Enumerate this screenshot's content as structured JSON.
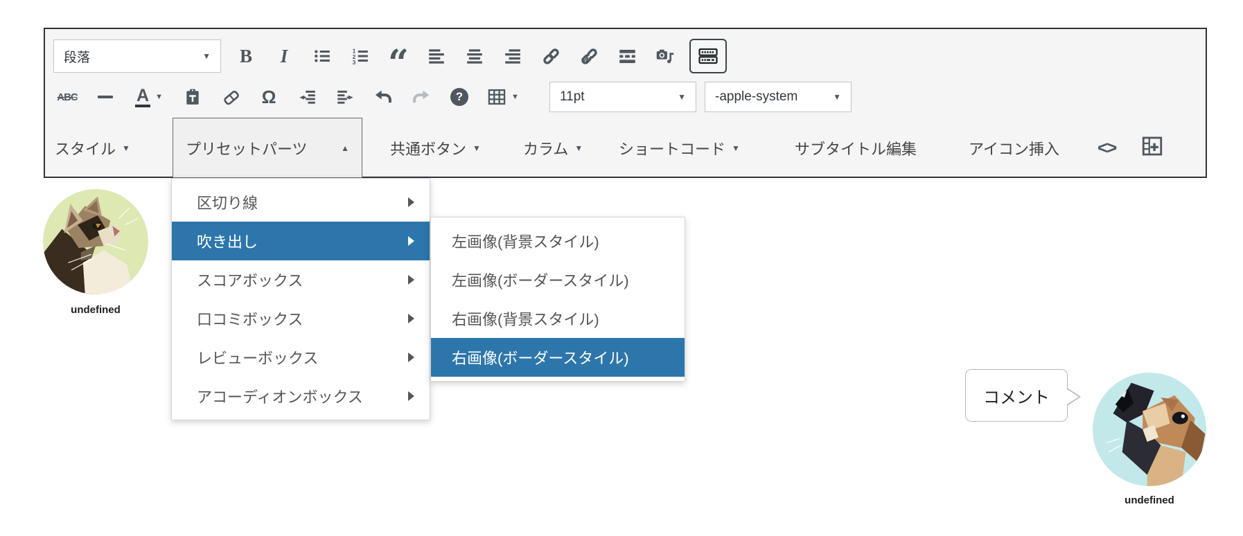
{
  "toolbar": {
    "block_format_value": "段落",
    "font_size_value": "11pt",
    "font_family_value": "-apple-system",
    "bold_glyph": "B",
    "italic_glyph": "I",
    "quote_glyph": "“",
    "strikethrough_glyph": "ABC",
    "special_char_glyph": "Ω",
    "help_glyph": "?",
    "code_glyph": "<>",
    "text_color_glyph": "A",
    "arrow_down": "▼",
    "arrow_up": "▲",
    "ol_digits": [
      "1",
      "2",
      "3"
    ],
    "row3": {
      "style_label": "スタイル",
      "preset_parts_label": "プリセットパーツ",
      "common_button_label": "共通ボタン",
      "column_label": "カラム",
      "shortcode_label": "ショートコード",
      "subtitle_edit_label": "サブタイトル編集",
      "icon_insert_label": "アイコン挿入"
    }
  },
  "menu": {
    "items": [
      {
        "label": "区切り線",
        "selected": false
      },
      {
        "label": "吹き出し",
        "selected": true
      },
      {
        "label": "スコアボックス",
        "selected": false
      },
      {
        "label": "口コミボックス",
        "selected": false
      },
      {
        "label": "レビューボックス",
        "selected": false
      },
      {
        "label": "アコーディオンボックス",
        "selected": false
      }
    ]
  },
  "submenu": {
    "items": [
      {
        "label": "左画像(背景スタイル)",
        "selected": false
      },
      {
        "label": "左画像(ボーダースタイル)",
        "selected": false
      },
      {
        "label": "右画像(背景スタイル)",
        "selected": false
      },
      {
        "label": "右画像(ボーダースタイル)",
        "selected": true
      }
    ]
  },
  "content": {
    "left_avatar_caption": "undefined",
    "bubble_text": "コメント",
    "right_avatar_caption": "undefined"
  },
  "colors": {
    "highlight": "#2d76ac",
    "toolbar_bg": "#f5f5f6",
    "toolbar_border": "#2f3338",
    "icon": "#50575e",
    "cat_bg": "#dde8b2",
    "dog_bg": "#c2e8ea"
  }
}
